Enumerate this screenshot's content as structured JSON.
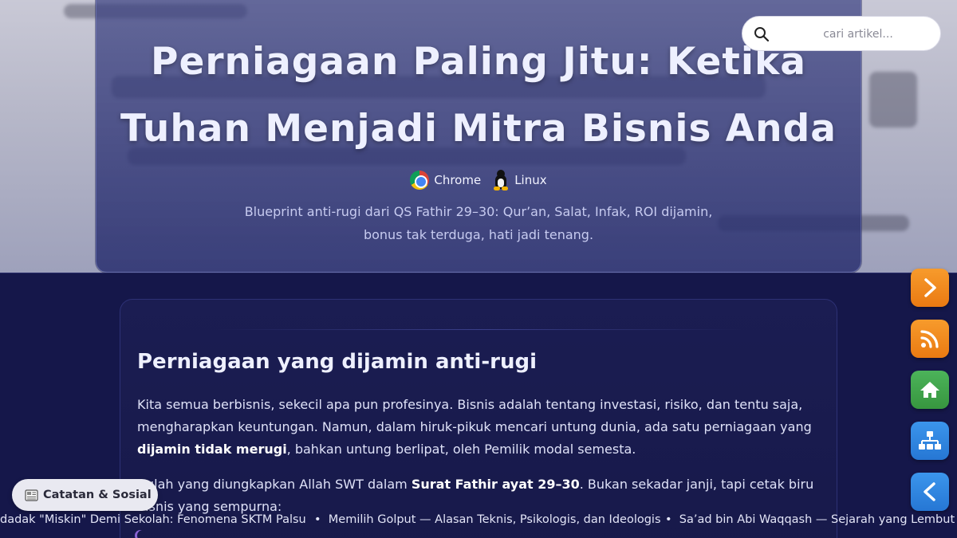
{
  "hero": {
    "title": "Perniagaan Paling Jitu: Ketika Tuhan Menjadi Mitra Bisnis Anda",
    "badges": [
      {
        "label": "Chrome",
        "icon": "chrome-icon"
      },
      {
        "label": "Linux",
        "icon": "linux-tux-icon"
      }
    ],
    "subtitle": "Blueprint anti-rugi dari QS Fathir 29–30: Qur’an, Salat, Infak, ROI dijamin, bonus tak terduga, hati jadi tenang."
  },
  "search": {
    "placeholder": "cari artikel...",
    "value": ""
  },
  "article": {
    "heading": "Perniagaan yang dijamin anti-rugi",
    "p1_a": "Kita semua berbisnis, sekecil apa pun profesinya. Bisnis adalah tentang investasi, risiko, dan tentu saja, mengharapkan keuntungan. Namun, dalam hiruk-pikuk mencari untung dunia, ada satu perniagaan yang ",
    "p1_bold": "dijamin tidak merugi",
    "p1_b": ", bahkan untung berlipat, oleh Pemilik modal semesta.",
    "p2_a": "Itulah yang diungkapkan Allah SWT dalam ",
    "p2_bold": "Surat Fathir ayat 29–30",
    "p2_b": ". Bukan sekadar janji, tapi cetak biru bisnis yang sempurna:"
  },
  "chip": {
    "icon": "newspaper-icon",
    "label": "Catatan & Sosial"
  },
  "ticker": {
    "items": [
      "dadak \"Miskin\" Demi Sekolah: Fenomena SKTM Palsu",
      "Memilih Golput — Alasan Teknis, Psikologis, dan Ideologis",
      "Sa’ad bin Abi Waqqash — Sejarah yang Lembut Hat"
    ]
  },
  "side_buttons": [
    {
      "name": "next-arrow-button",
      "icon": "chevron-right-icon",
      "color": "#f08a1c"
    },
    {
      "name": "rss-button",
      "icon": "rss-icon",
      "color": "#f08a1c"
    },
    {
      "name": "home-button",
      "icon": "home-icon",
      "color": "#3fa34d"
    },
    {
      "name": "sitemap-button",
      "icon": "sitemap-icon",
      "color": "#2f86e0"
    },
    {
      "name": "back-arrow-button",
      "icon": "chevron-left-icon",
      "color": "#2f86e0"
    }
  ]
}
